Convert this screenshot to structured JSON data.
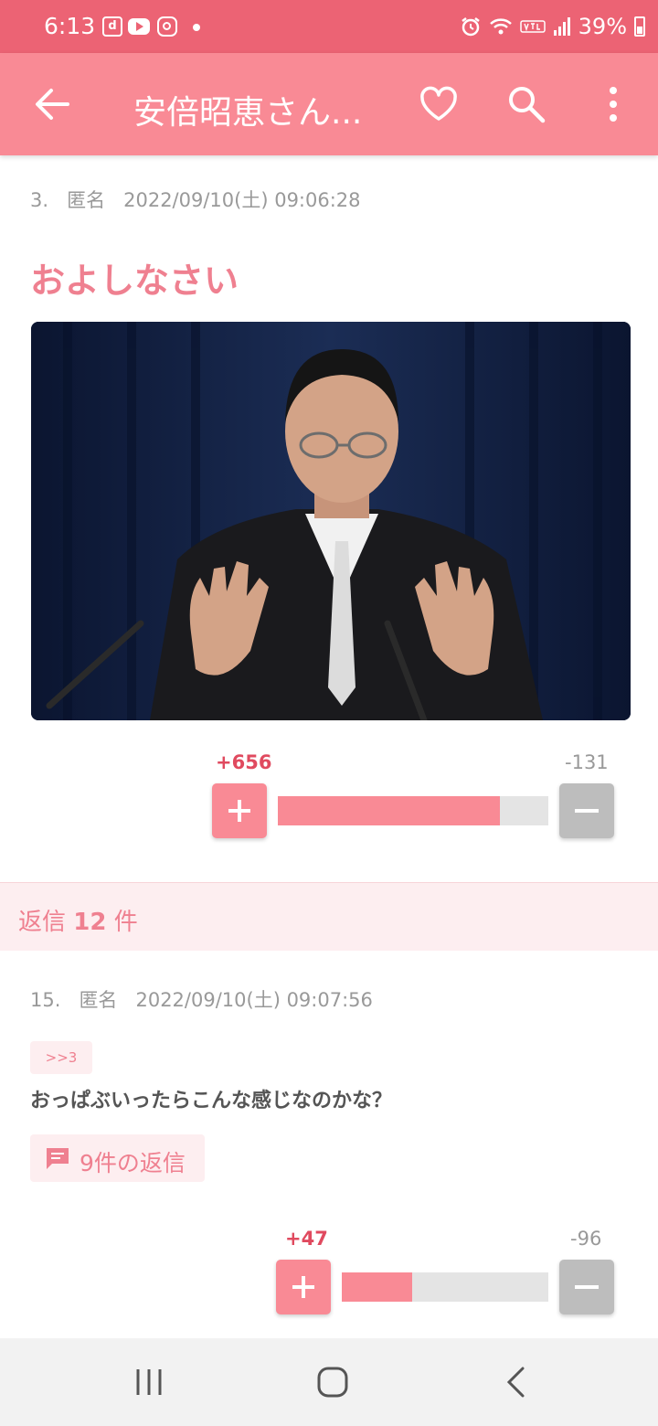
{
  "status_bar": {
    "time": "6:13",
    "d_icon_letter": "d",
    "battery": "39%"
  },
  "app_bar": {
    "title": "安倍昭恵さん..."
  },
  "post": {
    "number": "3.",
    "author": "匿名",
    "datetime": "2022/09/10(土) 09:06:28",
    "text": "およしなさい",
    "plus_count": "+656",
    "minus_count": "-131",
    "approval_fraction": 0.82
  },
  "replies_header": {
    "prefix": "返信",
    "count": "12",
    "suffix": "件"
  },
  "reply": {
    "number": "15.",
    "author": "匿名",
    "datetime": "2022/09/10(土) 09:07:56",
    "anchor": ">>3",
    "text": "おっぱぶいったらこんな感じなのかな？",
    "replies_link": "9件の返信",
    "plus_count": "+47",
    "minus_count": "-96",
    "approval_fraction": 0.34
  },
  "colors": {
    "status_bar": "#ec6374",
    "app_bar": "#f98a95",
    "accent": "#ef8090",
    "plus_text": "#e04a5f",
    "minus_button": "#bdbdbd"
  },
  "icons": [
    "back-arrow-icon",
    "heart-icon",
    "search-icon",
    "more-vert-icon",
    "plus-icon",
    "minus-icon",
    "comment-icon",
    "recent-apps-icon",
    "home-icon",
    "back-nav-icon"
  ]
}
